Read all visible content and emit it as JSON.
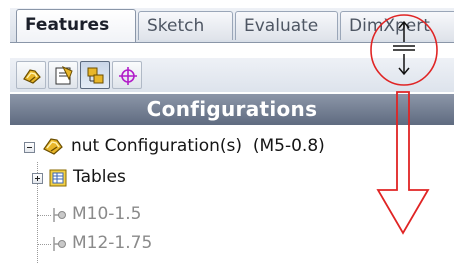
{
  "command_manager": {
    "tabs": [
      {
        "label": "Features",
        "active": true
      },
      {
        "label": "Sketch",
        "active": false
      },
      {
        "label": "Evaluate",
        "active": false
      },
      {
        "label": "DimXpert",
        "active": false
      }
    ]
  },
  "manager_toolbar": {
    "buttons": [
      {
        "icon": "feature-manager-icon",
        "pressed": false
      },
      {
        "icon": "property-manager-icon",
        "pressed": false
      },
      {
        "icon": "configuration-manager-icon",
        "pressed": true
      },
      {
        "icon": "dimxpert-manager-icon",
        "pressed": false
      }
    ]
  },
  "panel": {
    "header": "Configurations"
  },
  "tree": {
    "root_label": "nut Configuration(s)",
    "root_active": "(M5-0.8)",
    "tables_label": "Tables",
    "configurations": [
      "M10-1.5",
      "M12-1.75"
    ]
  },
  "annotation": {
    "circle_color": "#e02424",
    "arrow_color": "#e02424",
    "cursor_icon": "split-pane-cursor-icon"
  }
}
